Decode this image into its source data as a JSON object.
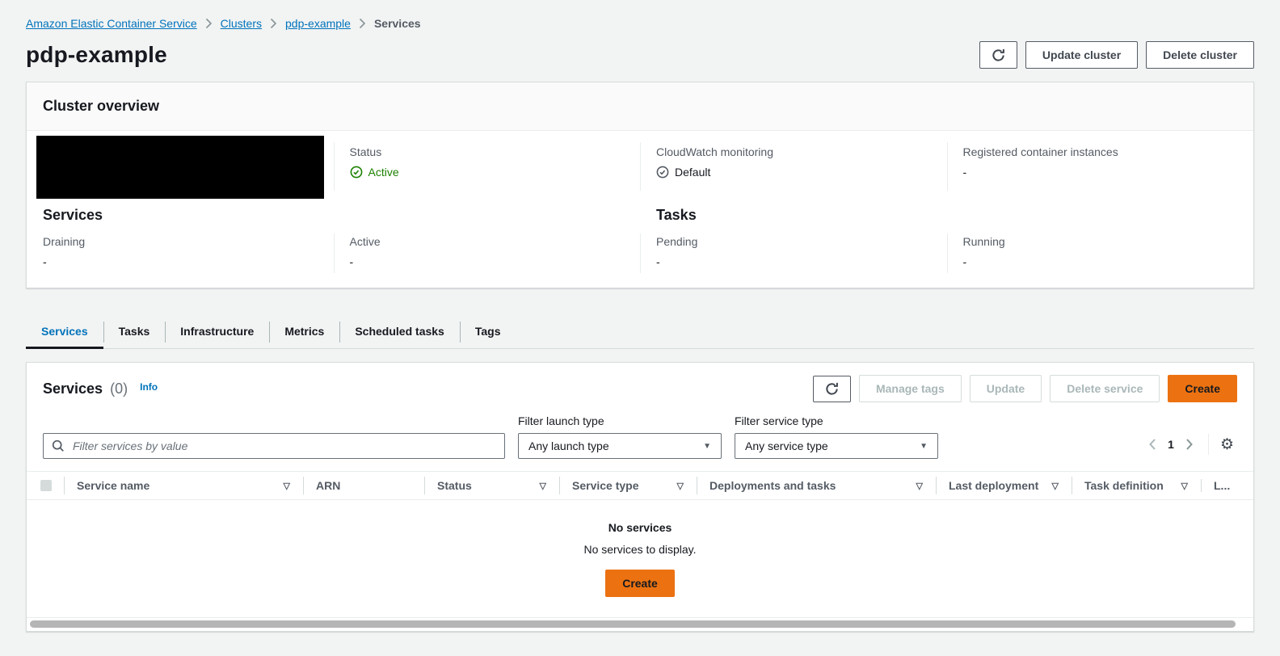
{
  "breadcrumb": {
    "items": [
      {
        "label": "Amazon Elastic Container Service"
      },
      {
        "label": "Clusters"
      },
      {
        "label": "pdp-example"
      },
      {
        "label": "Services"
      }
    ]
  },
  "page": {
    "title": "pdp-example"
  },
  "header_actions": {
    "update_label": "Update cluster",
    "delete_label": "Delete cluster"
  },
  "overview": {
    "title": "Cluster overview",
    "status": {
      "label": "Status",
      "value": "Active"
    },
    "cloudwatch": {
      "label": "CloudWatch monitoring",
      "value": "Default"
    },
    "instances": {
      "label": "Registered container instances",
      "value": "-"
    },
    "services": {
      "title": "Services",
      "draining": {
        "label": "Draining",
        "value": "-"
      },
      "active": {
        "label": "Active",
        "value": "-"
      }
    },
    "tasks": {
      "title": "Tasks",
      "pending": {
        "label": "Pending",
        "value": "-"
      },
      "running": {
        "label": "Running",
        "value": "-"
      }
    }
  },
  "tabs": [
    {
      "label": "Services"
    },
    {
      "label": "Tasks"
    },
    {
      "label": "Infrastructure"
    },
    {
      "label": "Metrics"
    },
    {
      "label": "Scheduled tasks"
    },
    {
      "label": "Tags"
    }
  ],
  "services_panel": {
    "title": "Services",
    "count": "(0)",
    "info_label": "Info",
    "actions": {
      "manage_tags": "Manage tags",
      "update": "Update",
      "delete": "Delete service",
      "create": "Create"
    },
    "filters": {
      "search_placeholder": "Filter services by value",
      "launch": {
        "label": "Filter launch type",
        "value": "Any launch type"
      },
      "service": {
        "label": "Filter service type",
        "value": "Any service type"
      }
    },
    "pagination": {
      "page": "1"
    },
    "table": {
      "columns": [
        {
          "label": "Service name"
        },
        {
          "label": "ARN"
        },
        {
          "label": "Status"
        },
        {
          "label": "Service type"
        },
        {
          "label": "Deployments and tasks"
        },
        {
          "label": "Last deployment"
        },
        {
          "label": "Task definition"
        },
        {
          "label": "L..."
        }
      ]
    },
    "empty": {
      "title": "No services",
      "message": "No services to display.",
      "create_label": "Create"
    }
  },
  "icons": {
    "filter": "▽",
    "caret_down": "▼",
    "gear": "⚙"
  },
  "colors": {
    "accent_orange": "#ec7211",
    "link_blue": "#0073bb",
    "status_green": "#1d8102",
    "page_bg": "#f2f3f3"
  }
}
